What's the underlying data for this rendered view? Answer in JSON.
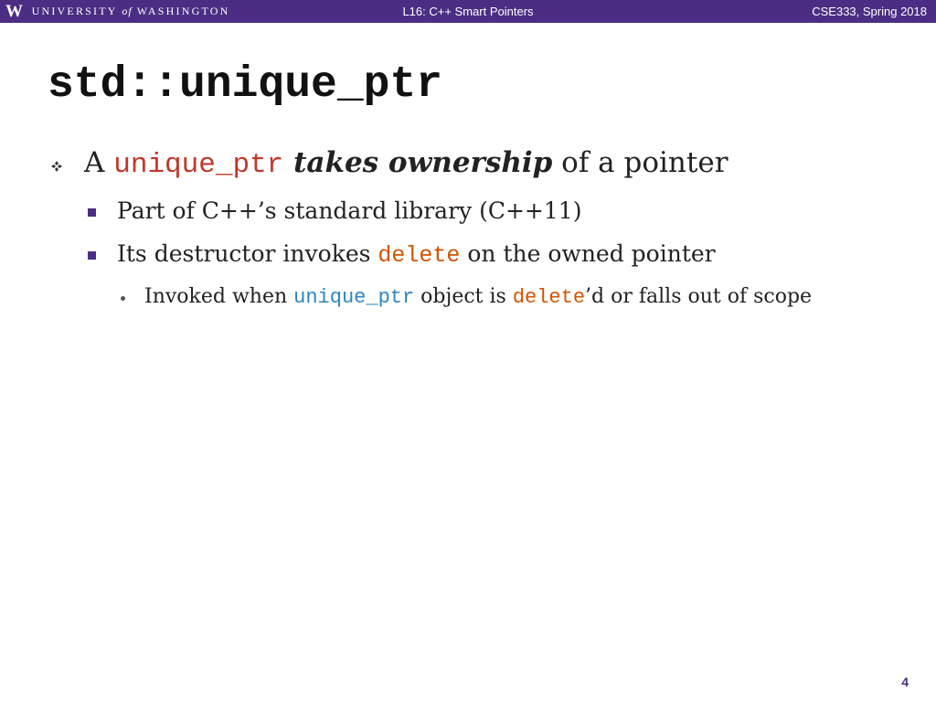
{
  "header": {
    "logo_letter": "W",
    "university_part1": "UNIVERSITY",
    "university_of": "of",
    "university_part2": "WASHINGTON",
    "lecture_title": "L16:  C++ Smart Pointers",
    "course": "CSE333, Spring 2018"
  },
  "slide": {
    "title": "std::unique_ptr",
    "bullet1": {
      "prefix": "A ",
      "code": "unique_ptr",
      "emph": " takes ownership",
      "suffix": " of a pointer"
    },
    "bullet2a": "Part of C++’s standard library (C++11)",
    "bullet2b": {
      "prefix": "Its destructor invokes ",
      "code": "delete",
      "suffix": " on the owned pointer"
    },
    "bullet3": {
      "prefix": "Invoked when ",
      "code1": "unique_ptr",
      "mid": " object is ",
      "code2": "delete",
      "suffix": "’d or falls out of scope"
    },
    "page_number": "4"
  },
  "colors": {
    "header_purple": "#4b2e83",
    "code_red": "#c0392b",
    "code_orange": "#d35400",
    "code_blue": "#2e86c1"
  }
}
